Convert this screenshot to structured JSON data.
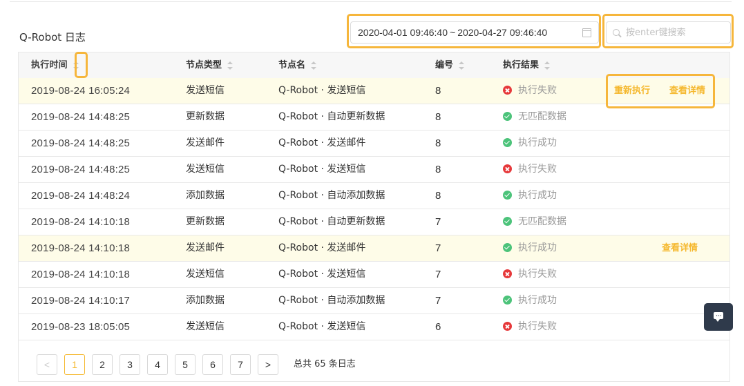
{
  "page": {
    "title": "Q-Robot 日志"
  },
  "filters": {
    "date_start": "2020-04-01 09:46:40",
    "date_sep": "~",
    "date_end": "2020-04-27 09:46:40",
    "search_placeholder": "按enter键搜索",
    "search_value": ""
  },
  "table": {
    "columns": [
      "执行时间",
      "节点类型",
      "节点名",
      "编号",
      "执行结果"
    ],
    "rows": [
      {
        "time": "2019-08-24 16:05:24",
        "type": "发送短信",
        "name": "Q-Robot · 发送短信",
        "num": "8",
        "result": "执行失败",
        "status": "fail",
        "actions": [
          "重新执行",
          "查看详情"
        ]
      },
      {
        "time": "2019-08-24 14:48:25",
        "type": "更新数据",
        "name": "Q-Robot · 自动更新数据",
        "num": "8",
        "result": "无匹配数据",
        "status": "ok",
        "actions": []
      },
      {
        "time": "2019-08-24 14:48:25",
        "type": "发送邮件",
        "name": "Q-Robot · 发送邮件",
        "num": "8",
        "result": "执行成功",
        "status": "ok",
        "actions": []
      },
      {
        "time": "2019-08-24 14:48:25",
        "type": "发送短信",
        "name": "Q-Robot · 发送短信",
        "num": "8",
        "result": "执行失败",
        "status": "fail",
        "actions": []
      },
      {
        "time": "2019-08-24 14:48:24",
        "type": "添加数据",
        "name": "Q-Robot · 自动添加数据",
        "num": "8",
        "result": "执行成功",
        "status": "ok",
        "actions": []
      },
      {
        "time": "2019-08-24 14:10:18",
        "type": "更新数据",
        "name": "Q-Robot · 自动更新数据",
        "num": "7",
        "result": "无匹配数据",
        "status": "ok",
        "actions": []
      },
      {
        "time": "2019-08-24 14:10:18",
        "type": "发送邮件",
        "name": "Q-Robot · 发送邮件",
        "num": "7",
        "result": "执行成功",
        "status": "ok",
        "actions": [
          "查看详情"
        ]
      },
      {
        "time": "2019-08-24 14:10:18",
        "type": "发送短信",
        "name": "Q-Robot · 发送短信",
        "num": "7",
        "result": "执行失败",
        "status": "fail",
        "actions": []
      },
      {
        "time": "2019-08-24 14:10:17",
        "type": "添加数据",
        "name": "Q-Robot · 自动添加数据",
        "num": "7",
        "result": "执行成功",
        "status": "ok",
        "actions": []
      },
      {
        "time": "2019-08-23 18:05:05",
        "type": "发送短信",
        "name": "Q-Robot · 发送短信",
        "num": "6",
        "result": "执行失败",
        "status": "fail",
        "actions": []
      }
    ]
  },
  "pagination": {
    "prev": "<",
    "pages": [
      "1",
      "2",
      "3",
      "4",
      "5",
      "6",
      "7"
    ],
    "current": "1",
    "next": ">",
    "total_text": "总共 65 条日志"
  },
  "icons": {
    "calendar": "calendar-icon",
    "search": "search-icon",
    "sort": "sort-icon",
    "success": "check-circle-icon",
    "failure": "close-circle-icon",
    "chat": "chat-icon"
  },
  "colors": {
    "accent": "#f5b82e",
    "highlight_border": "#f6b63b",
    "success": "#4cc37a",
    "failure": "#e6383a",
    "row_highlight": "#fefce8",
    "fab": "#2f3a4b"
  }
}
